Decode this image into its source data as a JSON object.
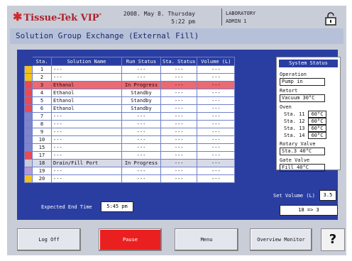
{
  "header": {
    "logo_text": "Tissue-Tek VIP",
    "logo_mark": "*",
    "date": "2008. May 8. Thursday",
    "time": "5:22 pm",
    "location": "LABORATORY",
    "user": "ADMIN 1",
    "lock_icon": "padlock-icon"
  },
  "title": "Solution Group Exchange (External Fill)",
  "table": {
    "headers": [
      "Sta.",
      "Solution Name",
      "Run Status",
      "Sta. Status",
      "Volume (L)"
    ],
    "rows": [
      {
        "marker": "#f2c21b",
        "sta": "1",
        "name": "---",
        "run": "---",
        "sst": "---",
        "vol": "---"
      },
      {
        "marker": "#f2c21b",
        "sta": "2",
        "name": "---",
        "run": "---",
        "sst": "---",
        "vol": "---"
      },
      {
        "marker": "#ea4b53",
        "sta": "3",
        "name": "Ethanol",
        "run": "In Progress",
        "sst": "---",
        "vol": "---"
      },
      {
        "marker": "#ea4b53",
        "sta": "4",
        "name": "Ethanol",
        "run": "Standby",
        "sst": "---",
        "vol": "---"
      },
      {
        "marker": "#ea4b53",
        "sta": "5",
        "name": "Ethanol",
        "run": "Standby",
        "sst": "---",
        "vol": "---"
      },
      {
        "marker": "#ea4b53",
        "sta": "6",
        "name": "Ethanol",
        "run": "Standby",
        "sst": "---",
        "vol": "---"
      },
      {
        "marker": "#7f84cc",
        "sta": "7",
        "name": "---",
        "run": "---",
        "sst": "---",
        "vol": "---"
      },
      {
        "marker": "#7f84cc",
        "sta": "8",
        "name": "---",
        "run": "---",
        "sst": "---",
        "vol": "---"
      },
      {
        "marker": "#7f84cc",
        "sta": "9",
        "name": "---",
        "run": "---",
        "sst": "---",
        "vol": "---"
      },
      {
        "marker": "#7f84cc",
        "sta": "10",
        "name": "---",
        "run": "---",
        "sst": "---",
        "vol": "---"
      },
      {
        "marker": "#7f84cc",
        "sta": "15",
        "name": "---",
        "run": "---",
        "sst": "---",
        "vol": "---"
      },
      {
        "marker": "#ea4b53",
        "sta": "17",
        "name": "---",
        "run": "---",
        "sst": "---",
        "vol": "---"
      },
      {
        "marker": "#c9cbd8",
        "sta": "18",
        "name": "Drain/Fill Port",
        "run": "In Progress",
        "sst": "---",
        "vol": "---"
      },
      {
        "marker": "#b39ad6",
        "sta": "19",
        "name": "---",
        "run": "---",
        "sst": "---",
        "vol": "---"
      },
      {
        "marker": "#f2c21b",
        "sta": "20",
        "name": "---",
        "run": "---",
        "sst": "---",
        "vol": "---"
      }
    ]
  },
  "expected_end": {
    "label": "Expected End Time",
    "value": "5:45 pm"
  },
  "system_status": {
    "title": "System Status",
    "operation_label": "Operation",
    "operation_value": "Pump in",
    "retort_label": "Retort",
    "retort_value": "Vacuum  30°C",
    "oven_label": "Oven",
    "ovens": [
      {
        "sta": "Sta. 11",
        "temp": "60°C"
      },
      {
        "sta": "Sta. 12",
        "temp": "60°C"
      },
      {
        "sta": "Sta. 13",
        "temp": "60°C"
      },
      {
        "sta": "Sta. 14",
        "temp": "60°C"
      }
    ],
    "rotary_label": "Rotary Valve",
    "rotary_value": "Sta.3  40°C",
    "gate_label": "Gate Valve",
    "gate_value": "Fill  40°C"
  },
  "set_volume": {
    "label": "Set Volume (L)",
    "value": "3.5"
  },
  "transfer": "18  =>  3",
  "buttons": {
    "logoff": "Log Off",
    "pause": "Pause",
    "menu": "Menu",
    "overview": "Overview Monitor",
    "help": "?"
  }
}
